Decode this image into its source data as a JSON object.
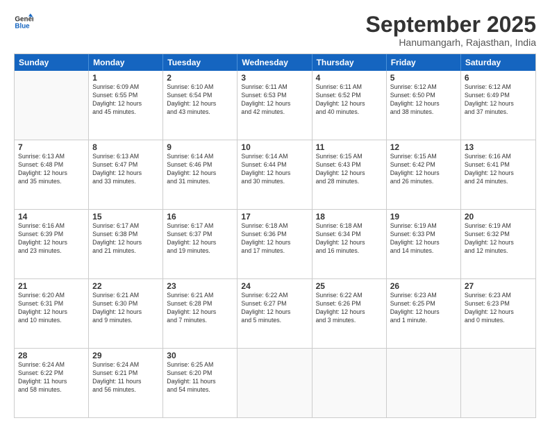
{
  "logo": {
    "line1": "General",
    "line2": "Blue"
  },
  "title": "September 2025",
  "subtitle": "Hanumangarh, Rajasthan, India",
  "days": [
    "Sunday",
    "Monday",
    "Tuesday",
    "Wednesday",
    "Thursday",
    "Friday",
    "Saturday"
  ],
  "weeks": [
    [
      {
        "day": "",
        "content": ""
      },
      {
        "day": "1",
        "content": "Sunrise: 6:09 AM\nSunset: 6:55 PM\nDaylight: 12 hours\nand 45 minutes."
      },
      {
        "day": "2",
        "content": "Sunrise: 6:10 AM\nSunset: 6:54 PM\nDaylight: 12 hours\nand 43 minutes."
      },
      {
        "day": "3",
        "content": "Sunrise: 6:11 AM\nSunset: 6:53 PM\nDaylight: 12 hours\nand 42 minutes."
      },
      {
        "day": "4",
        "content": "Sunrise: 6:11 AM\nSunset: 6:52 PM\nDaylight: 12 hours\nand 40 minutes."
      },
      {
        "day": "5",
        "content": "Sunrise: 6:12 AM\nSunset: 6:50 PM\nDaylight: 12 hours\nand 38 minutes."
      },
      {
        "day": "6",
        "content": "Sunrise: 6:12 AM\nSunset: 6:49 PM\nDaylight: 12 hours\nand 37 minutes."
      }
    ],
    [
      {
        "day": "7",
        "content": "Sunrise: 6:13 AM\nSunset: 6:48 PM\nDaylight: 12 hours\nand 35 minutes."
      },
      {
        "day": "8",
        "content": "Sunrise: 6:13 AM\nSunset: 6:47 PM\nDaylight: 12 hours\nand 33 minutes."
      },
      {
        "day": "9",
        "content": "Sunrise: 6:14 AM\nSunset: 6:46 PM\nDaylight: 12 hours\nand 31 minutes."
      },
      {
        "day": "10",
        "content": "Sunrise: 6:14 AM\nSunset: 6:44 PM\nDaylight: 12 hours\nand 30 minutes."
      },
      {
        "day": "11",
        "content": "Sunrise: 6:15 AM\nSunset: 6:43 PM\nDaylight: 12 hours\nand 28 minutes."
      },
      {
        "day": "12",
        "content": "Sunrise: 6:15 AM\nSunset: 6:42 PM\nDaylight: 12 hours\nand 26 minutes."
      },
      {
        "day": "13",
        "content": "Sunrise: 6:16 AM\nSunset: 6:41 PM\nDaylight: 12 hours\nand 24 minutes."
      }
    ],
    [
      {
        "day": "14",
        "content": "Sunrise: 6:16 AM\nSunset: 6:39 PM\nDaylight: 12 hours\nand 23 minutes."
      },
      {
        "day": "15",
        "content": "Sunrise: 6:17 AM\nSunset: 6:38 PM\nDaylight: 12 hours\nand 21 minutes."
      },
      {
        "day": "16",
        "content": "Sunrise: 6:17 AM\nSunset: 6:37 PM\nDaylight: 12 hours\nand 19 minutes."
      },
      {
        "day": "17",
        "content": "Sunrise: 6:18 AM\nSunset: 6:36 PM\nDaylight: 12 hours\nand 17 minutes."
      },
      {
        "day": "18",
        "content": "Sunrise: 6:18 AM\nSunset: 6:34 PM\nDaylight: 12 hours\nand 16 minutes."
      },
      {
        "day": "19",
        "content": "Sunrise: 6:19 AM\nSunset: 6:33 PM\nDaylight: 12 hours\nand 14 minutes."
      },
      {
        "day": "20",
        "content": "Sunrise: 6:19 AM\nSunset: 6:32 PM\nDaylight: 12 hours\nand 12 minutes."
      }
    ],
    [
      {
        "day": "21",
        "content": "Sunrise: 6:20 AM\nSunset: 6:31 PM\nDaylight: 12 hours\nand 10 minutes."
      },
      {
        "day": "22",
        "content": "Sunrise: 6:21 AM\nSunset: 6:30 PM\nDaylight: 12 hours\nand 9 minutes."
      },
      {
        "day": "23",
        "content": "Sunrise: 6:21 AM\nSunset: 6:28 PM\nDaylight: 12 hours\nand 7 minutes."
      },
      {
        "day": "24",
        "content": "Sunrise: 6:22 AM\nSunset: 6:27 PM\nDaylight: 12 hours\nand 5 minutes."
      },
      {
        "day": "25",
        "content": "Sunrise: 6:22 AM\nSunset: 6:26 PM\nDaylight: 12 hours\nand 3 minutes."
      },
      {
        "day": "26",
        "content": "Sunrise: 6:23 AM\nSunset: 6:25 PM\nDaylight: 12 hours\nand 1 minute."
      },
      {
        "day": "27",
        "content": "Sunrise: 6:23 AM\nSunset: 6:23 PM\nDaylight: 12 hours\nand 0 minutes."
      }
    ],
    [
      {
        "day": "28",
        "content": "Sunrise: 6:24 AM\nSunset: 6:22 PM\nDaylight: 11 hours\nand 58 minutes."
      },
      {
        "day": "29",
        "content": "Sunrise: 6:24 AM\nSunset: 6:21 PM\nDaylight: 11 hours\nand 56 minutes."
      },
      {
        "day": "30",
        "content": "Sunrise: 6:25 AM\nSunset: 6:20 PM\nDaylight: 11 hours\nand 54 minutes."
      },
      {
        "day": "",
        "content": ""
      },
      {
        "day": "",
        "content": ""
      },
      {
        "day": "",
        "content": ""
      },
      {
        "day": "",
        "content": ""
      }
    ]
  ]
}
